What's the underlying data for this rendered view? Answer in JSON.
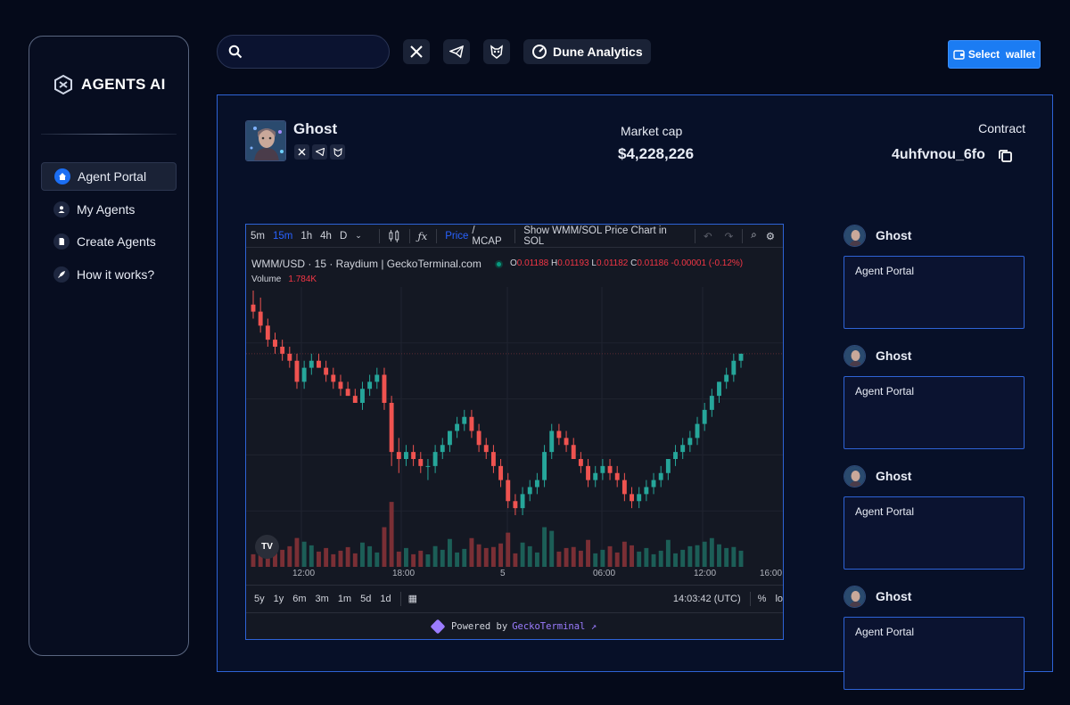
{
  "brand": {
    "name": "AGENTS AI"
  },
  "sidebar": {
    "items": [
      {
        "label": "Agent Portal",
        "icon": "home-icon",
        "active": true
      },
      {
        "label": "My Agents",
        "icon": "user-icon",
        "active": false
      },
      {
        "label": "Create Agents",
        "icon": "document-icon",
        "active": false
      },
      {
        "label": "How it works?",
        "icon": "rocket-icon",
        "active": false
      }
    ]
  },
  "topbar": {
    "search_placeholder": "",
    "dune_label": "Dune Analytics",
    "wallet_label": "Select  wallet"
  },
  "agent": {
    "name": "Ghost",
    "market_cap_label": "Market cap",
    "market_cap": "$4,228,226",
    "contract_label": "Contract",
    "contract": "4uhfvnou_6fo"
  },
  "chart_widget": {
    "intervals": [
      "5m",
      "15m",
      "1h",
      "4h",
      "D"
    ],
    "selected_interval": "15m",
    "price_label": "Price",
    "mcap_label": "/ MCAP",
    "show_label": "Show WMM/SOL Price Chart in SOL",
    "symbol_line": "WMM/USD · 15 · Raydium | GeckoTerminal.com",
    "ohlc": {
      "o": "0.01188",
      "h": "0.01193",
      "l": "0.01182",
      "c": "0.01186",
      "change": "-0.00001 (-0.12%)"
    },
    "volume_label": "Volume",
    "volume_value": "1.784K",
    "ranges": [
      "5y",
      "1y",
      "6m",
      "3m",
      "1m",
      "5d",
      "1d"
    ],
    "time": "14:03:42 (UTC)",
    "percent": "%",
    "log": "lo",
    "powered_prefix": "Powered by",
    "powered_brand": "GeckoTerminal ↗",
    "tv_badge": "TV"
  },
  "chart_data": {
    "type": "candlestick",
    "x_ticks": [
      "12:00",
      "18:00",
      "5",
      "06:00",
      "12:00",
      "16:00"
    ],
    "candles": [
      [
        0.0126,
        0.0128,
        0.0124,
        0.0125
      ],
      [
        0.0125,
        0.0127,
        0.0122,
        0.0123
      ],
      [
        0.0123,
        0.0124,
        0.012,
        0.0121
      ],
      [
        0.0121,
        0.0122,
        0.0119,
        0.012
      ],
      [
        0.012,
        0.0121,
        0.0118,
        0.0119
      ],
      [
        0.0119,
        0.012,
        0.0117,
        0.0118
      ],
      [
        0.0118,
        0.0119,
        0.0114,
        0.0115
      ],
      [
        0.0115,
        0.0118,
        0.0114,
        0.0117
      ],
      [
        0.0117,
        0.0119,
        0.0116,
        0.0118
      ],
      [
        0.0118,
        0.0119,
        0.0117,
        0.0117
      ],
      [
        0.0117,
        0.0118,
        0.0115,
        0.0116
      ],
      [
        0.0116,
        0.0117,
        0.0114,
        0.0115
      ],
      [
        0.0115,
        0.0116,
        0.0113,
        0.0114
      ],
      [
        0.0114,
        0.0115,
        0.0113,
        0.0113
      ],
      [
        0.0113,
        0.0114,
        0.0112,
        0.0112
      ],
      [
        0.0112,
        0.0115,
        0.0111,
        0.0114
      ],
      [
        0.0114,
        0.0116,
        0.0113,
        0.0115
      ],
      [
        0.0115,
        0.0117,
        0.0114,
        0.0116
      ],
      [
        0.0116,
        0.0117,
        0.0111,
        0.0112
      ],
      [
        0.0112,
        0.0113,
        0.0103,
        0.0105
      ],
      [
        0.0105,
        0.0107,
        0.0102,
        0.0104
      ],
      [
        0.0104,
        0.0106,
        0.0103,
        0.0105
      ],
      [
        0.0105,
        0.0106,
        0.0103,
        0.0104
      ],
      [
        0.0104,
        0.0105,
        0.0102,
        0.0103
      ],
      [
        0.0103,
        0.0104,
        0.0101,
        0.0103
      ],
      [
        0.0103,
        0.0106,
        0.0102,
        0.0105
      ],
      [
        0.0105,
        0.0107,
        0.0104,
        0.0106
      ],
      [
        0.0106,
        0.0108,
        0.0105,
        0.0108
      ],
      [
        0.0108,
        0.011,
        0.0107,
        0.0109
      ],
      [
        0.0109,
        0.0111,
        0.0108,
        0.011
      ],
      [
        0.011,
        0.0111,
        0.0107,
        0.0108
      ],
      [
        0.0108,
        0.0109,
        0.0105,
        0.0106
      ],
      [
        0.0106,
        0.0107,
        0.0104,
        0.0105
      ],
      [
        0.0105,
        0.0106,
        0.0102,
        0.0103
      ],
      [
        0.0103,
        0.0104,
        0.01,
        0.0101
      ],
      [
        0.0101,
        0.0102,
        0.0097,
        0.0098
      ],
      [
        0.0098,
        0.0099,
        0.0096,
        0.0097
      ],
      [
        0.0097,
        0.01,
        0.0096,
        0.0099
      ],
      [
        0.0099,
        0.0101,
        0.0098,
        0.01
      ],
      [
        0.01,
        0.0102,
        0.0099,
        0.0101
      ],
      [
        0.0101,
        0.0106,
        0.01,
        0.0105
      ],
      [
        0.0105,
        0.0109,
        0.0104,
        0.0108
      ],
      [
        0.0108,
        0.0109,
        0.0106,
        0.0107
      ],
      [
        0.0107,
        0.0108,
        0.0105,
        0.0106
      ],
      [
        0.0106,
        0.0107,
        0.0104,
        0.0104
      ],
      [
        0.0104,
        0.0105,
        0.0102,
        0.0103
      ],
      [
        0.0103,
        0.0104,
        0.01,
        0.0101
      ],
      [
        0.0101,
        0.0103,
        0.01,
        0.0102
      ],
      [
        0.0102,
        0.0104,
        0.0101,
        0.0103
      ],
      [
        0.0103,
        0.0104,
        0.0101,
        0.0102
      ],
      [
        0.0102,
        0.0103,
        0.01,
        0.0101
      ],
      [
        0.0101,
        0.0102,
        0.0098,
        0.0099
      ],
      [
        0.0099,
        0.01,
        0.0097,
        0.0098
      ],
      [
        0.0098,
        0.01,
        0.0097,
        0.0099
      ],
      [
        0.0099,
        0.0101,
        0.0098,
        0.01
      ],
      [
        0.01,
        0.0102,
        0.0099,
        0.0101
      ],
      [
        0.0101,
        0.0103,
        0.01,
        0.0102
      ],
      [
        0.0102,
        0.0104,
        0.0101,
        0.0104
      ],
      [
        0.0104,
        0.0106,
        0.0103,
        0.0105
      ],
      [
        0.0105,
        0.0107,
        0.0104,
        0.0106
      ],
      [
        0.0106,
        0.0108,
        0.0105,
        0.0107
      ],
      [
        0.0107,
        0.011,
        0.0106,
        0.0109
      ],
      [
        0.0109,
        0.0112,
        0.0108,
        0.0111
      ],
      [
        0.0111,
        0.0114,
        0.011,
        0.0113
      ],
      [
        0.0113,
        0.0115,
        0.0112,
        0.0115
      ],
      [
        0.0115,
        0.0117,
        0.0114,
        0.0116
      ],
      [
        0.0116,
        0.0119,
        0.0115,
        0.0118
      ],
      [
        0.0118,
        0.0119,
        0.0117,
        0.0119
      ]
    ]
  },
  "feed": [
    {
      "name": "Ghost",
      "text": "Agent Portal"
    },
    {
      "name": "Ghost",
      "text": "Agent Portal"
    },
    {
      "name": "Ghost",
      "text": "Agent Portal"
    },
    {
      "name": "Ghost",
      "text": "Agent Portal"
    }
  ]
}
